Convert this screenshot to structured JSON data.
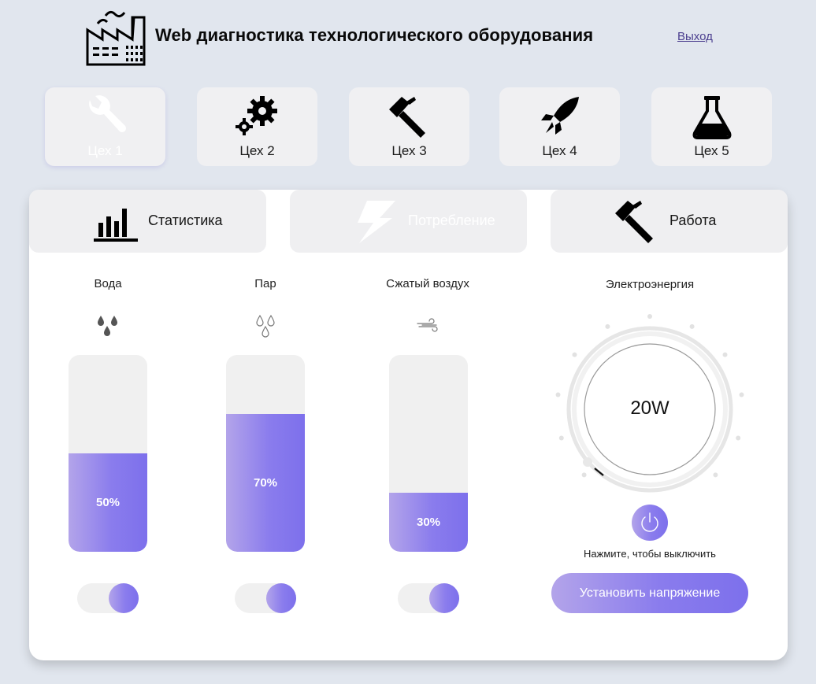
{
  "header": {
    "title": "Web диагностика технологического оборудования",
    "logout": "Выход",
    "logo_icon": "factory-icon"
  },
  "workshops": [
    {
      "label": "Цех 1",
      "icon": "wrench-icon",
      "active": true
    },
    {
      "label": "Цех 2",
      "icon": "gears-icon",
      "active": false
    },
    {
      "label": "Цех 3",
      "icon": "hammer-icon",
      "active": false
    },
    {
      "label": "Цех 4",
      "icon": "rocket-icon",
      "active": false
    },
    {
      "label": "Цех 5",
      "icon": "flask-icon",
      "active": false
    }
  ],
  "tabs": [
    {
      "label": "Статистика",
      "icon": "bar-chart-icon",
      "active": false
    },
    {
      "label": "Потребление",
      "icon": "lightning-icon",
      "active": true
    },
    {
      "label": "Работа",
      "icon": "hammer-icon",
      "active": false
    }
  ],
  "resources": [
    {
      "title": "Вода",
      "icon": "water-drops-icon",
      "percent": "50%",
      "level": 0.5,
      "enabled": true
    },
    {
      "title": "Пар",
      "icon": "steam-drops-icon",
      "percent": "70%",
      "level": 0.7,
      "enabled": true
    },
    {
      "title": "Сжатый воздух",
      "icon": "wind-icon",
      "percent": "30%",
      "level": 0.3,
      "enabled": true
    }
  ],
  "electricity": {
    "title": "Электроэнергия",
    "value": "20W",
    "hint": "Нажмите, чтобы выключить",
    "button": "Установить напряжение",
    "power_icon": "power-icon"
  },
  "colors": {
    "background": "#e1e6ee",
    "accent_start": "#b3a4ea",
    "accent_end": "#7d70ec",
    "tile": "#f0f0f2",
    "card": "#ffffff"
  }
}
